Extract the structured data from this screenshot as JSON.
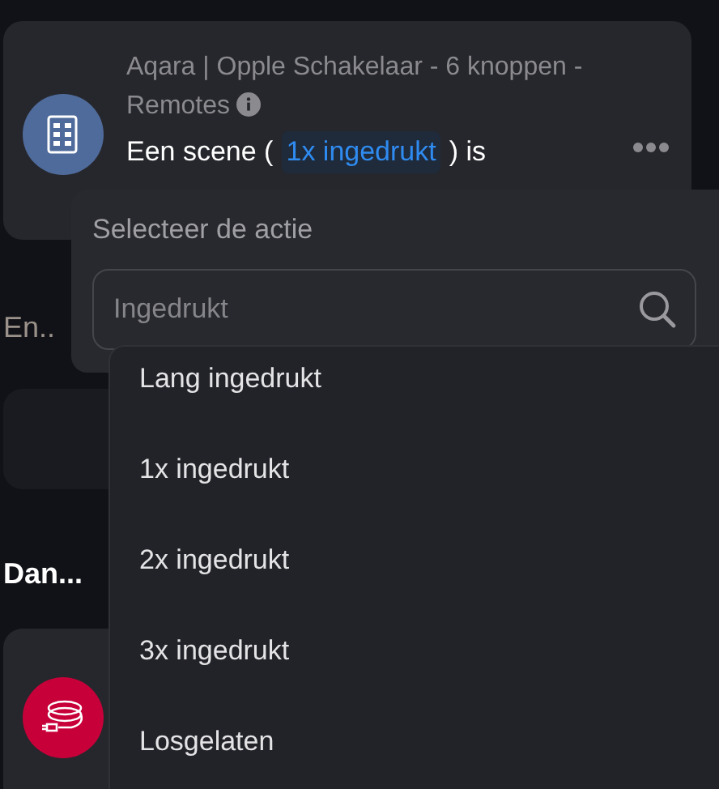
{
  "trigger_card": {
    "subtitle": "Aqara | Opple Schakelaar - 6 knoppen - Remotes",
    "sentence_before": "Een scene (",
    "chip": "1x ingedrukt",
    "sentence_after": ") is"
  },
  "and_heading": "En..",
  "then_heading": "Dan...",
  "popover": {
    "title": "Selecteer de actie",
    "search": {
      "placeholder": "Ingedrukt"
    }
  },
  "options": [
    {
      "label": "Lang ingedrukt"
    },
    {
      "label": "1x ingedrukt"
    },
    {
      "label": "2x ingedrukt"
    },
    {
      "label": "3x ingedrukt"
    },
    {
      "label": "Losgelaten"
    }
  ]
}
